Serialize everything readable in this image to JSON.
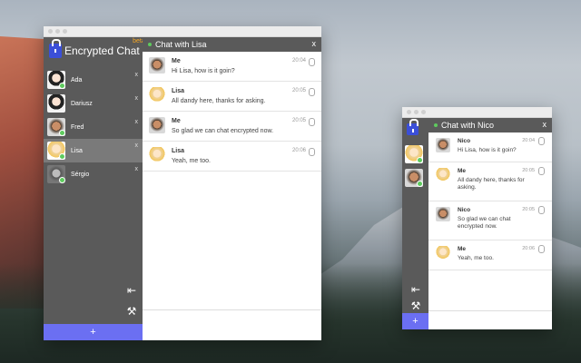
{
  "main": {
    "brand": {
      "title": "Encrypted Chat",
      "beta": "beta"
    },
    "contacts": [
      {
        "name": "Ada",
        "close": "x"
      },
      {
        "name": "Dariusz",
        "close": "x"
      },
      {
        "name": "Fred",
        "close": "x"
      },
      {
        "name": "Lisa",
        "close": "x"
      },
      {
        "name": "Sérgio",
        "close": "x"
      }
    ],
    "add_label": "+",
    "header": {
      "title": "Chat with Lisa",
      "close": "x"
    },
    "messages": [
      {
        "sender": "Me",
        "time": "20:04",
        "text": "Hi Lisa, how is it goin?"
      },
      {
        "sender": "Lisa",
        "time": "20:05",
        "text": "All dandy here, thanks for asking."
      },
      {
        "sender": "Me",
        "time": "20:05",
        "text": "So glad we can chat encrypted now."
      },
      {
        "sender": "Lisa",
        "time": "20:06",
        "text": "Yeah, me too."
      }
    ]
  },
  "second": {
    "add_label": "+",
    "header": {
      "title": "Chat with Nico",
      "close": "x"
    },
    "messages": [
      {
        "sender": "Nico",
        "time": "20:04",
        "text": "Hi Lisa, how is it goin?"
      },
      {
        "sender": "Me",
        "time": "20:05",
        "text": "All dandy here, thanks for asking."
      },
      {
        "sender": "Nico",
        "time": "20:05",
        "text": "So glad we can chat encrypted now."
      },
      {
        "sender": "Me",
        "time": "20:06",
        "text": "Yeah, me too."
      }
    ]
  },
  "colors": {
    "accent": "#6b6ff2",
    "sidebar": "#5a5a5a",
    "online": "#5ecb5e",
    "beta": "#f5a623"
  }
}
